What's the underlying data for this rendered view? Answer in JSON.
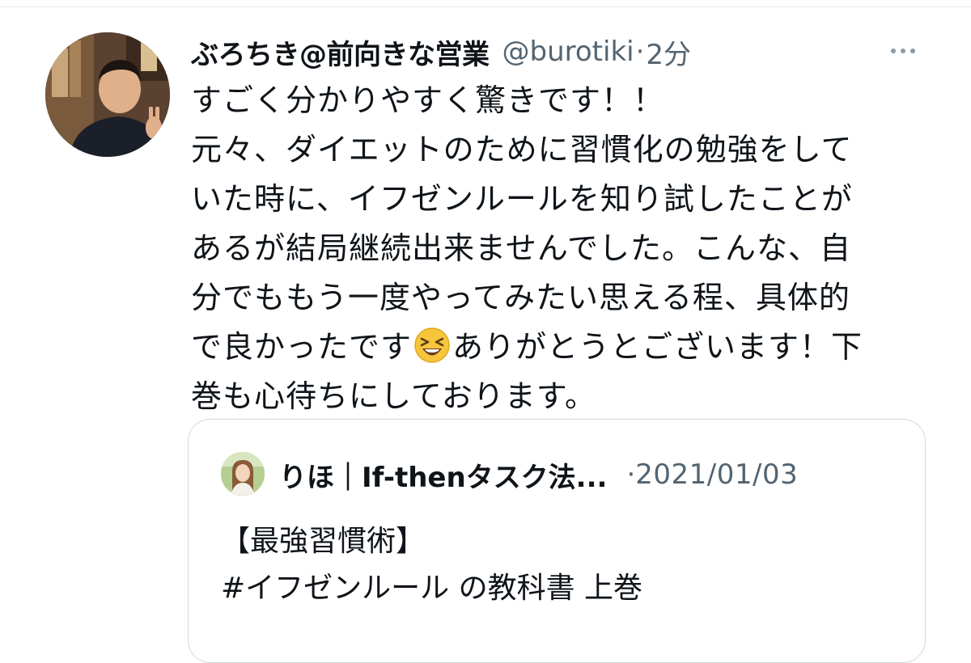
{
  "tweet": {
    "display_name": "ぶろちき@前向きな営業",
    "handle": "@burotiki",
    "separator": "·",
    "time": "2分",
    "text_lines": [
      "すごく分かりやすく驚きです！！",
      "元々、ダイエットのために習慣化の勉強をして",
      "いた時に、イフゼンルールを知り試したことが",
      "あるが結局継続出来ませんでした。こんな、自",
      "分でももう一度やってみたい思える程、具体的"
    ],
    "line6_before_emoji": "で良かったです",
    "line6_emoji": "grinning-squinting-face-emoji",
    "line6_after_emoji": "ありがとうとございます！下",
    "line7": "巻も心待ちにしております。"
  },
  "quoted_tweet": {
    "display_name": "りほ｜If-thenタスク法...",
    "separator": "·",
    "date": "2021/01/03",
    "text_lines": [
      "【最強習慣術】",
      "#イフゼンルール の教科書 上巻"
    ]
  },
  "icons": {
    "more": "more-horizontal-icon",
    "emoji": "grinning-squinting-face-emoji"
  },
  "colors": {
    "text_primary": "#0f1419",
    "text_secondary": "#536471",
    "border": "#cfd9de"
  }
}
